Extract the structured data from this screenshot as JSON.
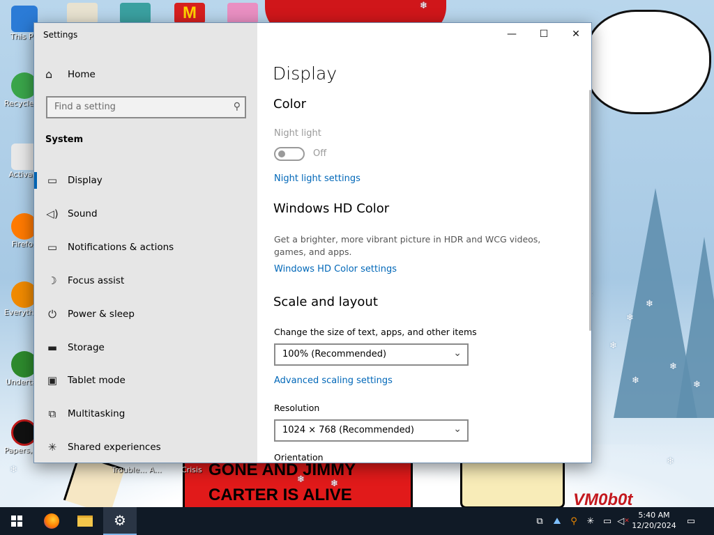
{
  "desktop": {
    "icons": [
      {
        "label": "This PC",
        "color": "#2b7bd6"
      },
      {
        "label": "Recycle Bin",
        "color": "#3aa54a"
      },
      {
        "label": "Activate",
        "color": "#e8e8e8"
      },
      {
        "label": "Firefox",
        "color": "#ff7a00"
      },
      {
        "label": "Everything",
        "color": "#f08a00"
      },
      {
        "label": "Undertale",
        "color": "#2d8a2d"
      },
      {
        "label": "Papers, Please",
        "color": "#c01818"
      }
    ],
    "top_icons": [
      {
        "name": "folder-shortcut",
        "color": "#e8e2d0"
      },
      {
        "name": "game-shortcut",
        "color": "#3aa0a0"
      },
      {
        "name": "mcdonalds-shortcut",
        "color": "#d61f1f"
      },
      {
        "name": "anime-shortcut",
        "color": "#e98fc2"
      }
    ],
    "bottom_labels": {
      "left": "Trouble... A...",
      "right": "Crisis"
    },
    "wallpaper_text": {
      "banner_line1": "GONE AND JIMMY",
      "banner_line2": "CARTER IS ALIVE",
      "signature": "VM0b0t"
    }
  },
  "window": {
    "title": "Settings",
    "caption": {
      "minimize": "—",
      "maximize": "☐",
      "close": "✕"
    }
  },
  "nav": {
    "home_label": "Home",
    "search_placeholder": "Find a setting",
    "section_label": "System",
    "items": [
      {
        "label": "Display",
        "icon": "monitor-icon",
        "glyph": "🖵",
        "selected": true
      },
      {
        "label": "Sound",
        "icon": "speaker-icon",
        "glyph": "🔊",
        "selected": false
      },
      {
        "label": "Notifications & actions",
        "icon": "notifications-icon",
        "glyph": "▭",
        "selected": false
      },
      {
        "label": "Focus assist",
        "icon": "moon-icon",
        "glyph": "☽",
        "selected": false
      },
      {
        "label": "Power & sleep",
        "icon": "power-icon",
        "glyph": "⏻",
        "selected": false
      },
      {
        "label": "Storage",
        "icon": "storage-icon",
        "glyph": "▬",
        "selected": false
      },
      {
        "label": "Tablet mode",
        "icon": "tablet-icon",
        "glyph": "▣",
        "selected": false
      },
      {
        "label": "Multitasking",
        "icon": "multitasking-icon",
        "glyph": "⧉",
        "selected": false
      },
      {
        "label": "Shared experiences",
        "icon": "shared-experiences-icon",
        "glyph": "✳",
        "selected": false
      }
    ]
  },
  "main": {
    "page_title": "Display",
    "color_heading": "Color",
    "night_light_label": "Night light",
    "night_light_state": "Off",
    "night_light_settings_link": "Night light settings",
    "hd_color_heading": "Windows HD Color",
    "hd_color_description": "Get a brighter, more vibrant picture in HDR and WCG videos, games, and apps.",
    "hd_color_settings_link": "Windows HD Color settings",
    "scale_heading": "Scale and layout",
    "scale_label": "Change the size of text, apps, and other items",
    "scale_value": "100% (Recommended)",
    "advanced_scaling_link": "Advanced scaling settings",
    "resolution_label": "Resolution",
    "resolution_value": "1024 × 768 (Recommended)",
    "orientation_label": "Orientation"
  },
  "taskbar": {
    "start": "start-icon",
    "apps": [
      {
        "name": "firefox-taskbar-icon",
        "color": "#ff7a00"
      },
      {
        "name": "file-explorer-taskbar-icon",
        "color": "#f3c64b"
      },
      {
        "name": "settings-taskbar-icon",
        "color": "#ffffff",
        "active": true
      }
    ],
    "tray": [
      {
        "name": "task-view-tray-icon",
        "glyph": "⧉"
      },
      {
        "name": "app-tray-icon",
        "glyph": "⛰"
      },
      {
        "name": "search-tray-icon",
        "glyph": "⚲"
      },
      {
        "name": "sparkle-tray-icon",
        "glyph": "✳"
      },
      {
        "name": "network-tray-icon",
        "glyph": "🖧"
      },
      {
        "name": "volume-muted-icon",
        "glyph": "🔇"
      }
    ],
    "time": "5:40 AM",
    "date": "12/20/2024",
    "notification_icon": "notification-center-icon"
  }
}
